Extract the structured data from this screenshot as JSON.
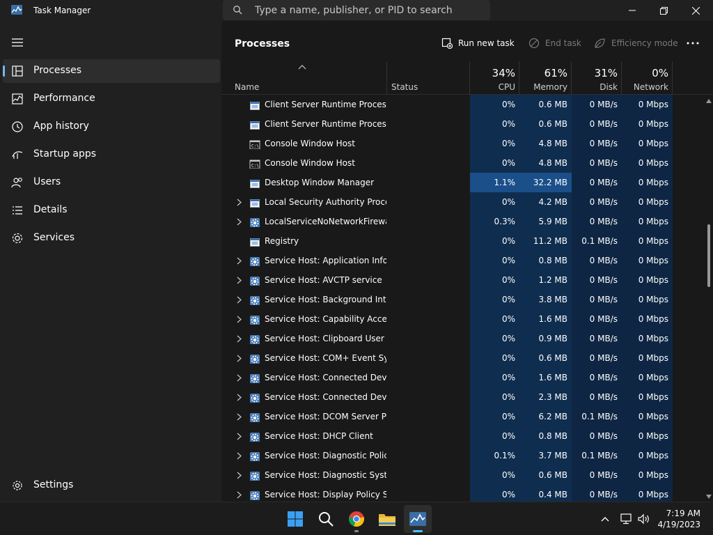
{
  "window": {
    "title": "Task Manager",
    "search_placeholder": "Type a name, publisher, or PID to search"
  },
  "sidebar": {
    "items": [
      {
        "label": "Processes",
        "icon": "processes-icon",
        "active": true
      },
      {
        "label": "Performance",
        "icon": "performance-icon"
      },
      {
        "label": "App history",
        "icon": "app-history-icon"
      },
      {
        "label": "Startup apps",
        "icon": "startup-apps-icon"
      },
      {
        "label": "Users",
        "icon": "users-icon"
      },
      {
        "label": "Details",
        "icon": "details-icon"
      },
      {
        "label": "Services",
        "icon": "services-icon"
      }
    ],
    "settings_label": "Settings"
  },
  "toolbar": {
    "title": "Processes",
    "run_new_task": "Run new task",
    "end_task": "End task",
    "efficiency_mode": "Efficiency mode"
  },
  "columns": {
    "name": "Name",
    "status": "Status",
    "cpu": {
      "pct": "34%",
      "label": "CPU"
    },
    "memory": {
      "pct": "61%",
      "label": "Memory"
    },
    "disk": {
      "pct": "31%",
      "label": "Disk"
    },
    "network": {
      "pct": "0%",
      "label": "Network"
    }
  },
  "colors": {
    "accent": "#76b9ed",
    "heat_low": "#0f2d4f",
    "heat_high": "#1a4f8a"
  },
  "processes": [
    {
      "name": "Client Server Runtime Process",
      "expand": false,
      "icon": "window-icon",
      "cpu": "0%",
      "memory": "0.6 MB",
      "disk": "0 MB/s",
      "network": "0 Mbps"
    },
    {
      "name": "Client Server Runtime Process",
      "expand": false,
      "icon": "window-icon",
      "cpu": "0%",
      "memory": "0.6 MB",
      "disk": "0 MB/s",
      "network": "0 Mbps"
    },
    {
      "name": "Console Window Host",
      "expand": false,
      "icon": "console-icon",
      "cpu": "0%",
      "memory": "4.8 MB",
      "disk": "0 MB/s",
      "network": "0 Mbps"
    },
    {
      "name": "Console Window Host",
      "expand": false,
      "icon": "console-icon",
      "cpu": "0%",
      "memory": "4.8 MB",
      "disk": "0 MB/s",
      "network": "0 Mbps"
    },
    {
      "name": "Desktop Window Manager",
      "expand": false,
      "icon": "window-icon",
      "cpu": "1.1%",
      "memory": "32.2 MB",
      "disk": "0 MB/s",
      "network": "0 Mbps",
      "hot": true
    },
    {
      "name": "Local Security Authority Proce...",
      "expand": true,
      "icon": "window-icon",
      "cpu": "0%",
      "memory": "4.2 MB",
      "disk": "0 MB/s",
      "network": "0 Mbps"
    },
    {
      "name": "LocalServiceNoNetworkFirewa...",
      "expand": true,
      "icon": "gear-icon",
      "cpu": "0.3%",
      "memory": "5.9 MB",
      "disk": "0 MB/s",
      "network": "0 Mbps"
    },
    {
      "name": "Registry",
      "expand": false,
      "icon": "window-icon",
      "cpu": "0%",
      "memory": "11.2 MB",
      "disk": "0.1 MB/s",
      "network": "0 Mbps"
    },
    {
      "name": "Service Host: Application Infor...",
      "expand": true,
      "icon": "gear-icon",
      "cpu": "0%",
      "memory": "0.8 MB",
      "disk": "0 MB/s",
      "network": "0 Mbps"
    },
    {
      "name": "Service Host: AVCTP service",
      "expand": true,
      "icon": "gear-icon",
      "cpu": "0%",
      "memory": "1.2 MB",
      "disk": "0 MB/s",
      "network": "0 Mbps"
    },
    {
      "name": "Service Host: Background Inte...",
      "expand": true,
      "icon": "gear-icon",
      "cpu": "0%",
      "memory": "3.8 MB",
      "disk": "0 MB/s",
      "network": "0 Mbps"
    },
    {
      "name": "Service Host: Capability Acces...",
      "expand": true,
      "icon": "gear-icon",
      "cpu": "0%",
      "memory": "1.6 MB",
      "disk": "0 MB/s",
      "network": "0 Mbps"
    },
    {
      "name": "Service Host: Clipboard User S...",
      "expand": true,
      "icon": "gear-icon",
      "cpu": "0%",
      "memory": "0.9 MB",
      "disk": "0 MB/s",
      "network": "0 Mbps"
    },
    {
      "name": "Service Host: COM+ Event Sys...",
      "expand": true,
      "icon": "gear-icon",
      "cpu": "0%",
      "memory": "0.6 MB",
      "disk": "0 MB/s",
      "network": "0 Mbps"
    },
    {
      "name": "Service Host: Connected Devi...",
      "expand": true,
      "icon": "gear-icon",
      "cpu": "0%",
      "memory": "1.6 MB",
      "disk": "0 MB/s",
      "network": "0 Mbps"
    },
    {
      "name": "Service Host: Connected Devi...",
      "expand": true,
      "icon": "gear-icon",
      "cpu": "0%",
      "memory": "2.3 MB",
      "disk": "0 MB/s",
      "network": "0 Mbps"
    },
    {
      "name": "Service Host: DCOM Server Pr...",
      "expand": true,
      "icon": "gear-icon",
      "cpu": "0%",
      "memory": "6.2 MB",
      "disk": "0.1 MB/s",
      "network": "0 Mbps"
    },
    {
      "name": "Service Host: DHCP Client",
      "expand": true,
      "icon": "gear-icon",
      "cpu": "0%",
      "memory": "0.8 MB",
      "disk": "0 MB/s",
      "network": "0 Mbps"
    },
    {
      "name": "Service Host: Diagnostic Polic...",
      "expand": true,
      "icon": "gear-icon",
      "cpu": "0.1%",
      "memory": "3.7 MB",
      "disk": "0.1 MB/s",
      "network": "0 Mbps"
    },
    {
      "name": "Service Host: Diagnostic Syste...",
      "expand": true,
      "icon": "gear-icon",
      "cpu": "0%",
      "memory": "0.6 MB",
      "disk": "0 MB/s",
      "network": "0 Mbps"
    },
    {
      "name": "Service Host: Display Policy Se...",
      "expand": true,
      "icon": "gear-icon",
      "cpu": "0%",
      "memory": "0.4 MB",
      "disk": "0 MB/s",
      "network": "0 Mbps"
    }
  ],
  "taskbar": {
    "apps": [
      {
        "name": "start-button",
        "icon": "windows-logo-icon"
      },
      {
        "name": "search-button",
        "icon": "search-icon"
      },
      {
        "name": "chrome-app",
        "icon": "chrome-icon"
      },
      {
        "name": "file-explorer-app",
        "icon": "folder-icon"
      },
      {
        "name": "task-manager-app",
        "icon": "task-manager-icon"
      }
    ],
    "time": "7:19 AM",
    "date": "4/19/2023"
  }
}
